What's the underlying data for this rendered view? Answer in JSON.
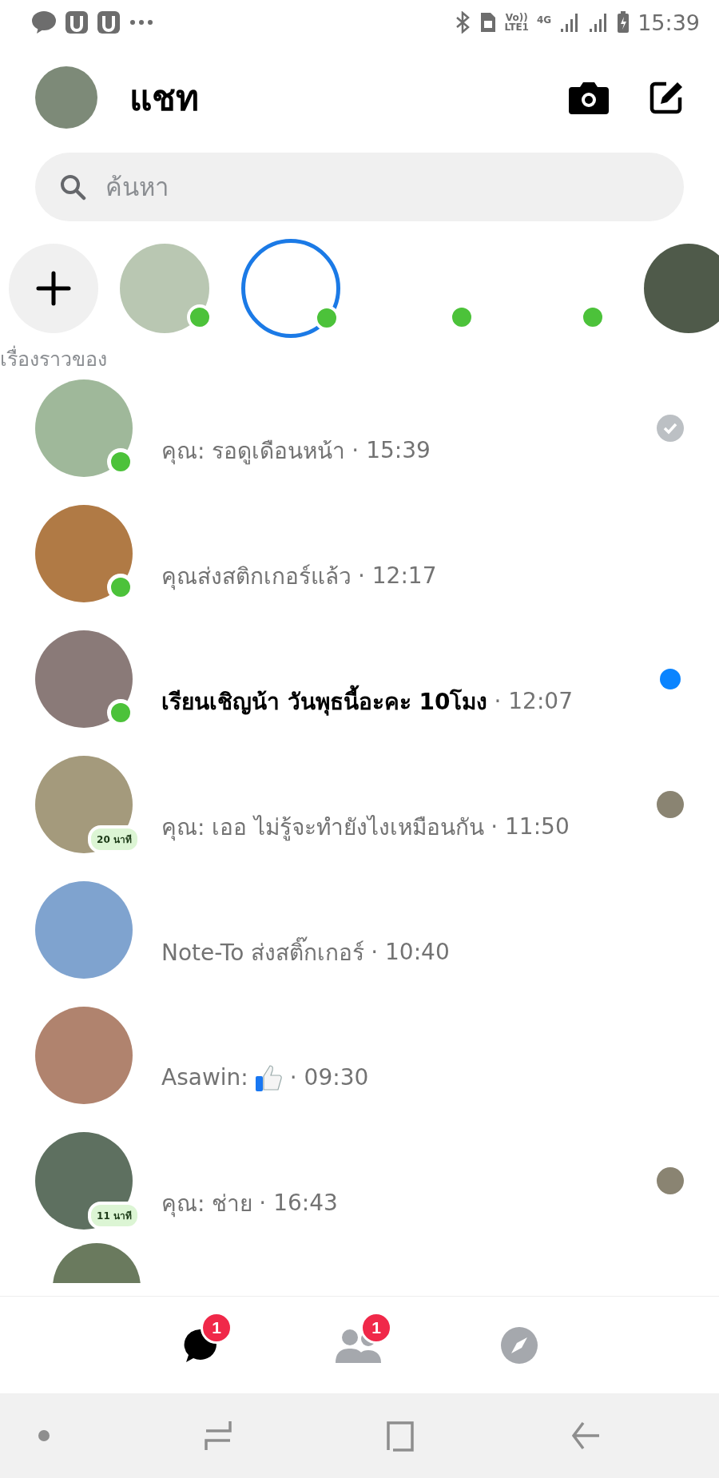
{
  "status_bar": {
    "volte": "Vo))",
    "lte": "LTE1",
    "network": "4G",
    "time": "15:39"
  },
  "header": {
    "title": "แชท"
  },
  "search": {
    "placeholder": "ค้นหา"
  },
  "stories": {
    "add_label": "เรื่องราวของ",
    "items": [
      {
        "kind": "photo",
        "online": true
      },
      {
        "kind": "ring",
        "online": true
      },
      {
        "kind": "blank",
        "online": true
      },
      {
        "kind": "blank",
        "online": true
      },
      {
        "kind": "partial",
        "online": false
      }
    ]
  },
  "chats": [
    {
      "message": "คุณ: รอดูเดือนหน้า",
      "time": "· 15:39",
      "unread": false,
      "online": true,
      "kind": "seen"
    },
    {
      "message": "คุณส่งสติกเกอร์แล้ว",
      "time": "· 12:17",
      "unread": false,
      "online": true,
      "kind": "plain"
    },
    {
      "message": "เรียนเชิญน้า วันพุธนี้อะคะ 10โมง",
      "time": "· 12:07",
      "unread": true,
      "online": true,
      "kind": "unread"
    },
    {
      "message": "คุณ: เออ ไม่รู้จะทำยังไงเหมือนกัน",
      "time": "· 11:50",
      "unread": false,
      "online": false,
      "active_ago": "20 นาที",
      "kind": "read"
    },
    {
      "message": "Note-To ส่งสติ๊กเกอร์",
      "time": "· 10:40",
      "unread": false,
      "online": false,
      "kind": "plain"
    },
    {
      "message": "Asawin:",
      "like_sticker": true,
      "time": "· 09:30",
      "unread": false,
      "online": false,
      "kind": "plain"
    },
    {
      "message": "คุณ: ช่าย",
      "time": "· 16:43",
      "unread": false,
      "online": false,
      "active_ago": "11 นาที",
      "kind": "read"
    }
  ],
  "bottom_nav": [
    {
      "kind": "chats",
      "selected": true,
      "badge": "1"
    },
    {
      "kind": "people",
      "selected": false,
      "badge": "1"
    },
    {
      "kind": "discover",
      "selected": false
    }
  ]
}
